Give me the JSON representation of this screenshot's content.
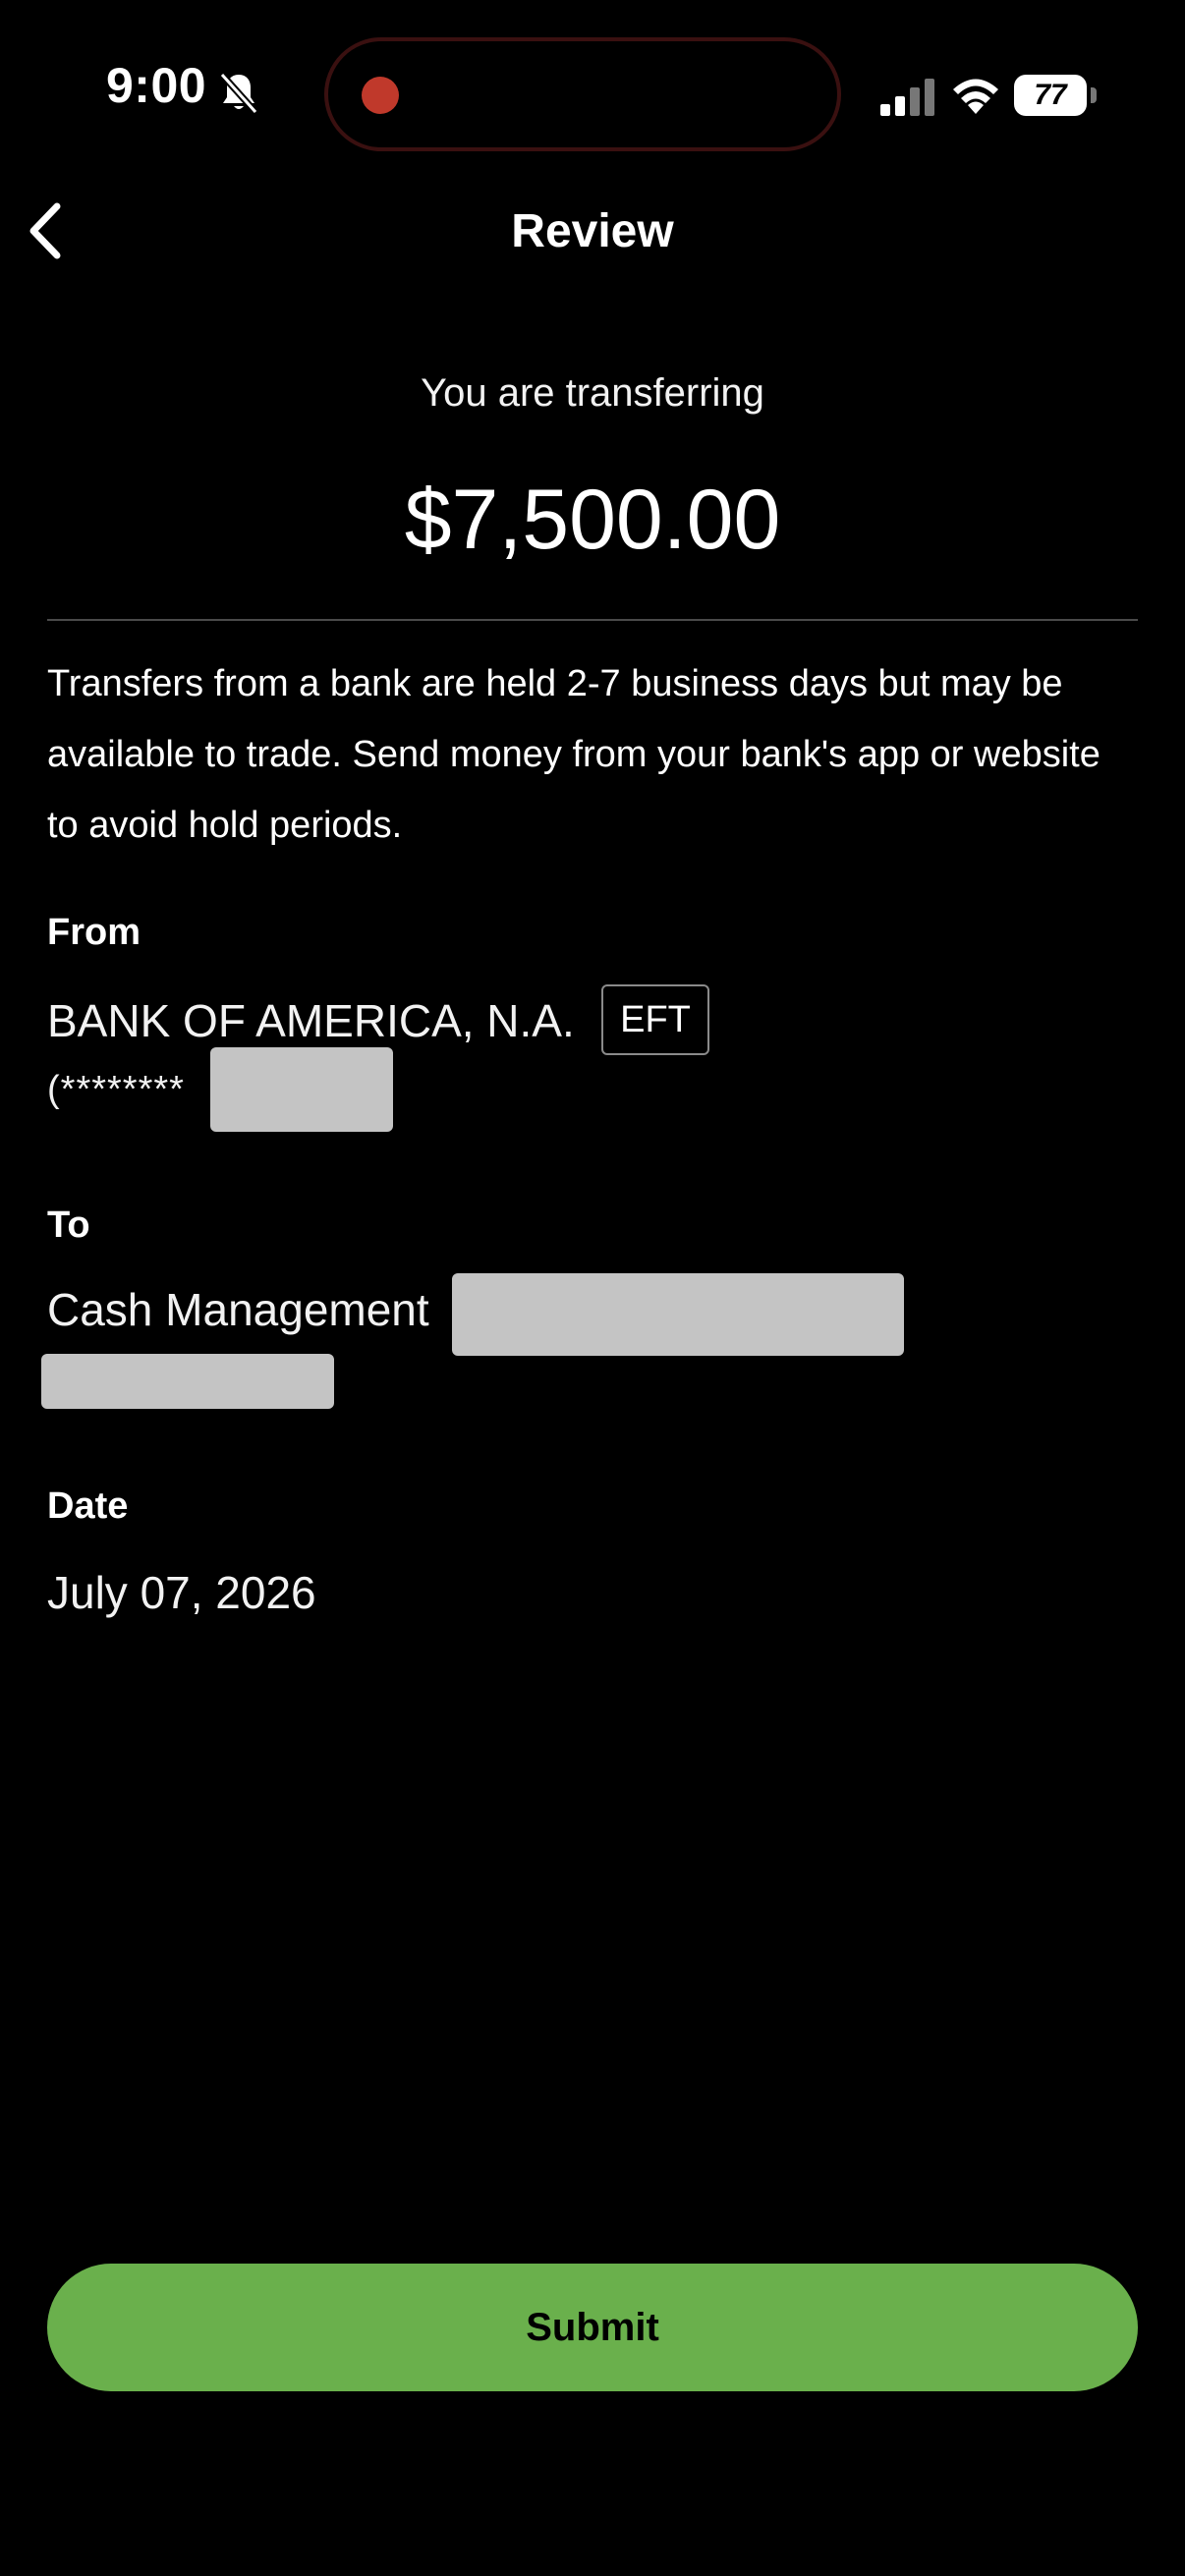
{
  "status_bar": {
    "time": "9:00",
    "battery": "77"
  },
  "nav": {
    "title": "Review"
  },
  "transfer": {
    "subtitle": "You are transferring",
    "amount": "$7,500.00",
    "notice": "Transfers from a bank are held 2-7 business days but may be available to trade. Send money from your bank's app or website to avoid hold periods."
  },
  "from": {
    "label": "From",
    "bank": "BANK OF AMERICA, N.A.",
    "badge": "EFT",
    "account_mask": "(********"
  },
  "to": {
    "label": "To",
    "account": "Cash Management"
  },
  "date": {
    "label": "Date",
    "value": "July 07, 2026"
  },
  "actions": {
    "submit": "Submit"
  },
  "colors": {
    "background": "#000000",
    "submit": "#6ab04c",
    "redaction": "#c4c4c4"
  }
}
